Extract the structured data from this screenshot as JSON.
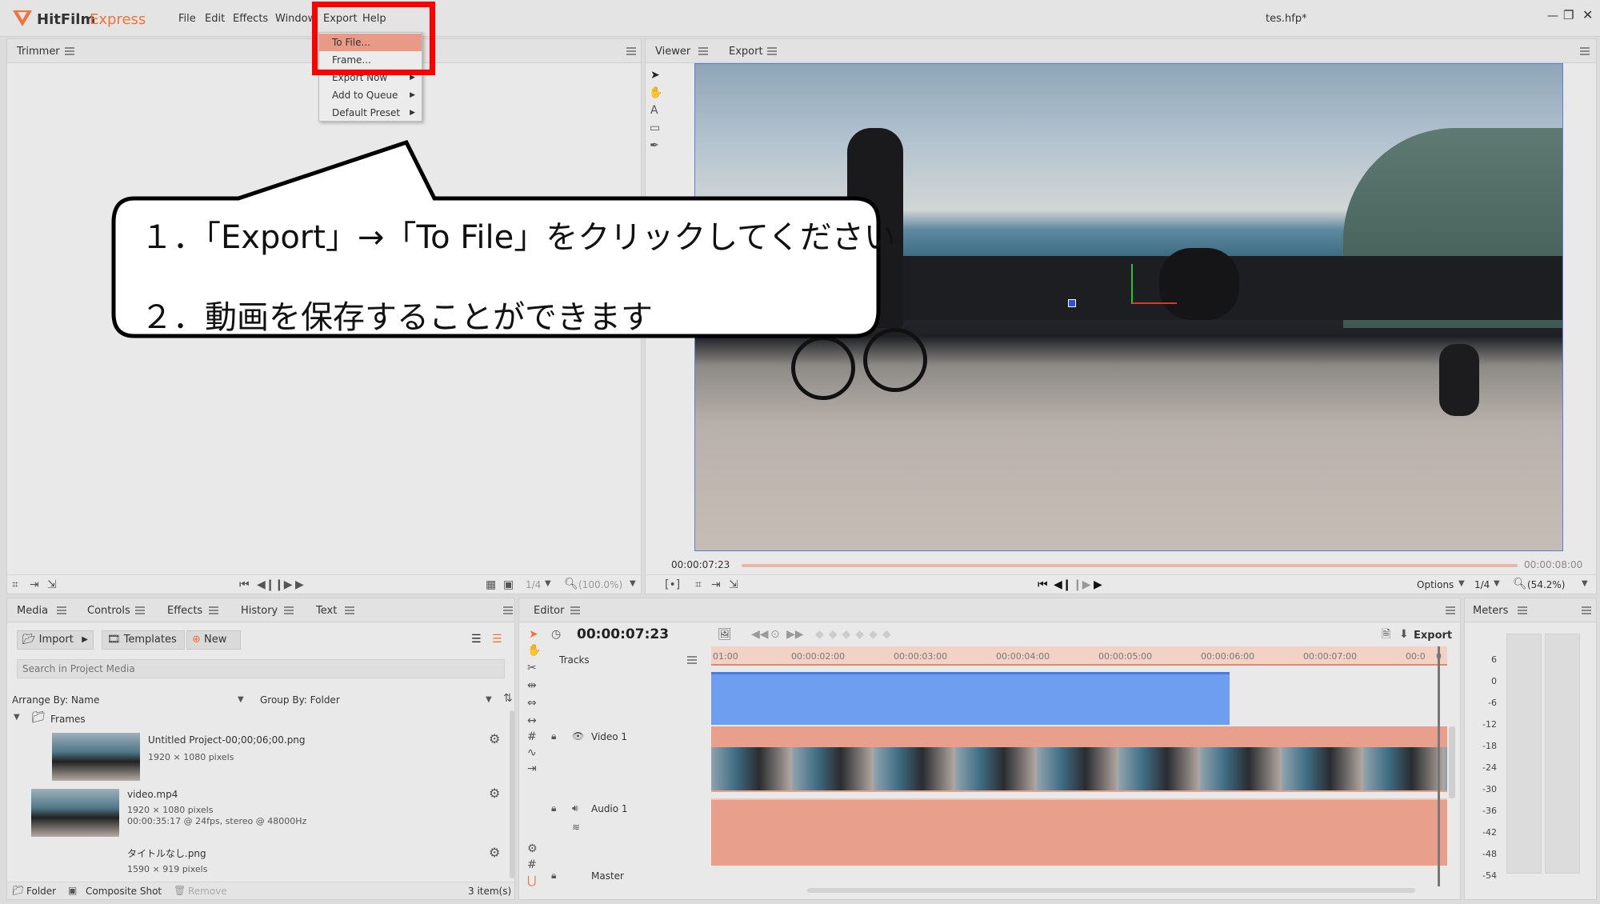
{
  "app": {
    "name_a": "HitFilm",
    "name_b": "Express",
    "file_title": "tes.hfp*"
  },
  "menubar": [
    "File",
    "Edit",
    "Effects",
    "Window",
    "Export",
    "Help"
  ],
  "export_menu": [
    {
      "label": "To File...",
      "highlight": true
    },
    {
      "label": "Frame...",
      "highlight": false
    },
    {
      "label": "Export Now",
      "sub": true
    },
    {
      "label": "Add to Queue",
      "sub": true
    },
    {
      "label": "Default Preset",
      "sub": true
    }
  ],
  "trimmer": {
    "tab": "Trimmer",
    "quality": "1/4",
    "zoom": "(100.0%)"
  },
  "viewer": {
    "tabs": [
      "Viewer",
      "Export"
    ],
    "time_start": "00:00:07:23",
    "time_end": "00:00:08:00",
    "options": "Options",
    "quality": "1/4",
    "zoom": "(54.2%)"
  },
  "callout": {
    "line1": "１．「Export」→「To File」をクリックしてください",
    "line2": "２．動画を保存することができます"
  },
  "media": {
    "tabs": [
      "Media",
      "Controls",
      "Effects",
      "History",
      "Text"
    ],
    "import": "Import",
    "templates": "Templates",
    "new": "New",
    "search_placeholder": "Search in Project Media",
    "arrange": "Arrange By: Name",
    "group": "Group By: Folder",
    "folder": "Frames",
    "items": [
      {
        "name": "Untitled Project-00;00;06;00.png",
        "info1": "1920 × 1080 pixels",
        "info2": ""
      },
      {
        "name": "video.mp4",
        "info1": "1920 × 1080 pixels",
        "info2": "00:00:35:17 @ 24fps, stereo @ 48000Hz"
      },
      {
        "name": "タイトルなし.png",
        "info1": "1590 × 919 pixels",
        "info2": ""
      }
    ],
    "footer_folder": "Folder",
    "footer_comp": "Composite Shot",
    "footer_remove": "Remove",
    "footer_count": "3 item(s)"
  },
  "editor": {
    "tab": "Editor",
    "timecode": "00:00:07:23",
    "export": "Export",
    "tracks_label": "Tracks",
    "video_track": "Video 1",
    "audio_track": "Audio 1",
    "master": "Master",
    "ruler": [
      "01:00",
      "00:00:02:00",
      "00:00:03:00",
      "00:00:04:00",
      "00:00:05:00",
      "00:00:06:00",
      "00:00:07:00",
      "00:0"
    ],
    "ruler_last": "0"
  },
  "meters": {
    "tab": "Meters",
    "scale": [
      "6",
      "0",
      "-6",
      "-12",
      "-18",
      "-24",
      "-30",
      "-36",
      "-42",
      "-48",
      "-54"
    ]
  },
  "colors": {
    "accent": "#f0733a",
    "highlight_red": "#ff0000",
    "clip_blue": "#6d9ef0",
    "clip_salmon": "#e8a08c"
  }
}
